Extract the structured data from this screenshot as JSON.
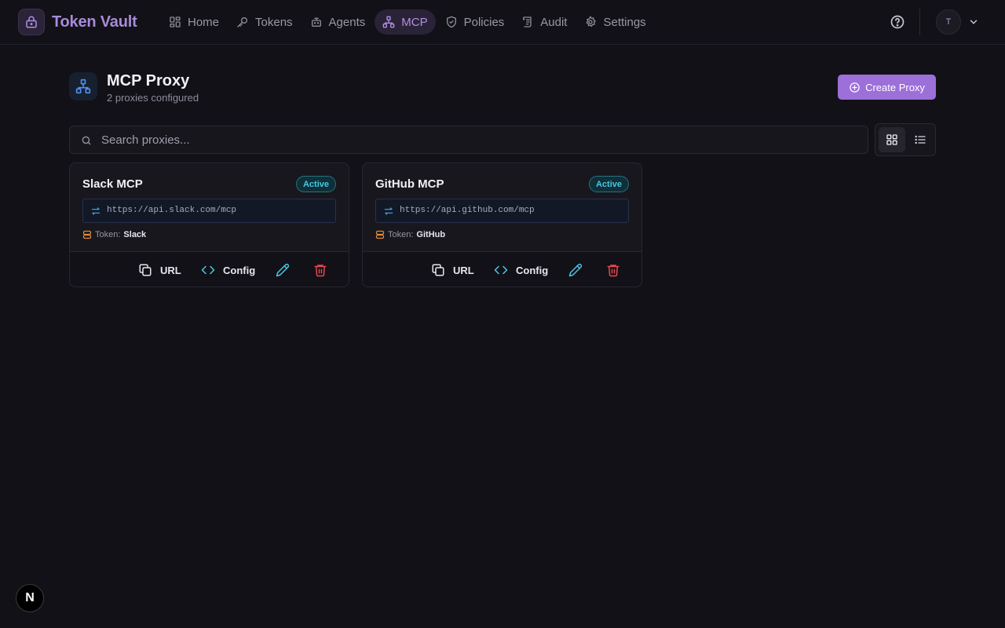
{
  "app": {
    "name": "Token Vault",
    "avatar_initial": "T"
  },
  "nav": {
    "items": [
      {
        "label": "Home",
        "icon": "grid-icon"
      },
      {
        "label": "Tokens",
        "icon": "key-icon"
      },
      {
        "label": "Agents",
        "icon": "bot-icon"
      },
      {
        "label": "MCP",
        "icon": "network-icon",
        "active": true
      },
      {
        "label": "Policies",
        "icon": "shield-check-icon"
      },
      {
        "label": "Audit",
        "icon": "scroll-icon"
      },
      {
        "label": "Settings",
        "icon": "gear-icon"
      }
    ]
  },
  "page": {
    "title": "MCP Proxy",
    "subtitle": "2 proxies configured",
    "create_label": "Create Proxy"
  },
  "search": {
    "placeholder": "Search proxies...",
    "value": ""
  },
  "proxies": [
    {
      "name": "Slack MCP",
      "status": "Active",
      "url": "https://api.slack.com/mcp",
      "token_label": "Token:",
      "token": "Slack"
    },
    {
      "name": "GitHub MCP",
      "status": "Active",
      "url": "https://api.github.com/mcp",
      "token_label": "Token:",
      "token": "GitHub"
    }
  ],
  "card_actions": {
    "url_label": "URL",
    "config_label": "Config"
  },
  "colors": {
    "background": "#121117",
    "accent": "#9c6fd9",
    "brand_text": "#a88bd8",
    "active_badge": "#49c7e3",
    "delete": "#e5484d"
  },
  "framework_badge": "N"
}
